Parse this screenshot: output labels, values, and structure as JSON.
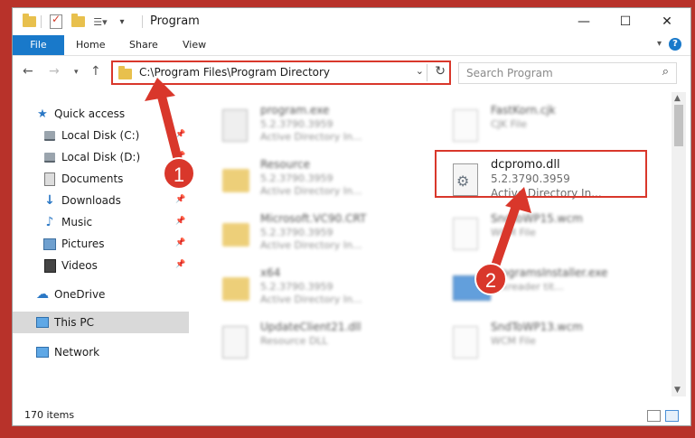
{
  "window": {
    "title": "Program"
  },
  "ribbon": {
    "tabs": [
      "File",
      "Home",
      "Share",
      "View"
    ]
  },
  "address": {
    "path": "C:\\Program Files\\Program Directory"
  },
  "search": {
    "placeholder": "Search Program"
  },
  "sidebar": {
    "items": [
      {
        "label": "Quick access",
        "icon": "star-icon"
      },
      {
        "label": "Local Disk (C:)",
        "icon": "disk-icon",
        "pinned": true
      },
      {
        "label": "Local Disk (D:)",
        "icon": "disk-icon",
        "pinned": true
      },
      {
        "label": "Documents",
        "icon": "documents-icon",
        "pinned": true
      },
      {
        "label": "Downloads",
        "icon": "download-icon",
        "pinned": true
      },
      {
        "label": "Music",
        "icon": "music-icon",
        "pinned": true
      },
      {
        "label": "Pictures",
        "icon": "pictures-icon",
        "pinned": true
      },
      {
        "label": "Videos",
        "icon": "videos-icon",
        "pinned": true
      },
      {
        "label": "OneDrive",
        "icon": "cloud-icon"
      },
      {
        "label": "This PC",
        "icon": "computer-icon",
        "selected": true
      },
      {
        "label": "Network",
        "icon": "network-icon"
      }
    ]
  },
  "files": [
    {
      "name": "program.exe",
      "line2": "5.2.3790.3959",
      "line3": "Active Directory In...",
      "icon": "exe-icon"
    },
    {
      "name": "FastKorn.cjk",
      "line2": "CJK File",
      "line3": "",
      "icon": "document-icon"
    },
    {
      "name": "Resource",
      "line2": "5.2.3790.3959",
      "line3": "Active Directory In...",
      "icon": "folder-icon"
    },
    {
      "name": "dcpromo.dll",
      "line2": "5.2.3790.3959",
      "line3": "Active Directory In...",
      "icon": "dll-gear-icon"
    },
    {
      "name": "Microsoft.VC90.CRT",
      "line2": "5.2.3790.3959",
      "line3": "Active Directory In...",
      "icon": "folder-icon"
    },
    {
      "name": "SndToWP15.wcm",
      "line2": "WCM File",
      "line3": "",
      "icon": "document-icon"
    },
    {
      "name": "x64",
      "line2": "5.2.3790.3959",
      "line3": "Active Directory In...",
      "icon": "folder-icon"
    },
    {
      "name": "ProgramsInstaller.exe",
      "line2": "Foxreader tit...",
      "line3": "",
      "icon": "installer-icon"
    },
    {
      "name": "UpdateClient21.dll",
      "line2": "Resource DLL",
      "line3": "",
      "icon": "dll-icon"
    },
    {
      "name": "SndToWP13.wcm",
      "line2": "WCM File",
      "line3": "",
      "icon": "document-icon"
    }
  ],
  "status": {
    "count": "170 items"
  },
  "annotations": {
    "step1": "1",
    "step2": "2",
    "color": "#d9372b"
  }
}
